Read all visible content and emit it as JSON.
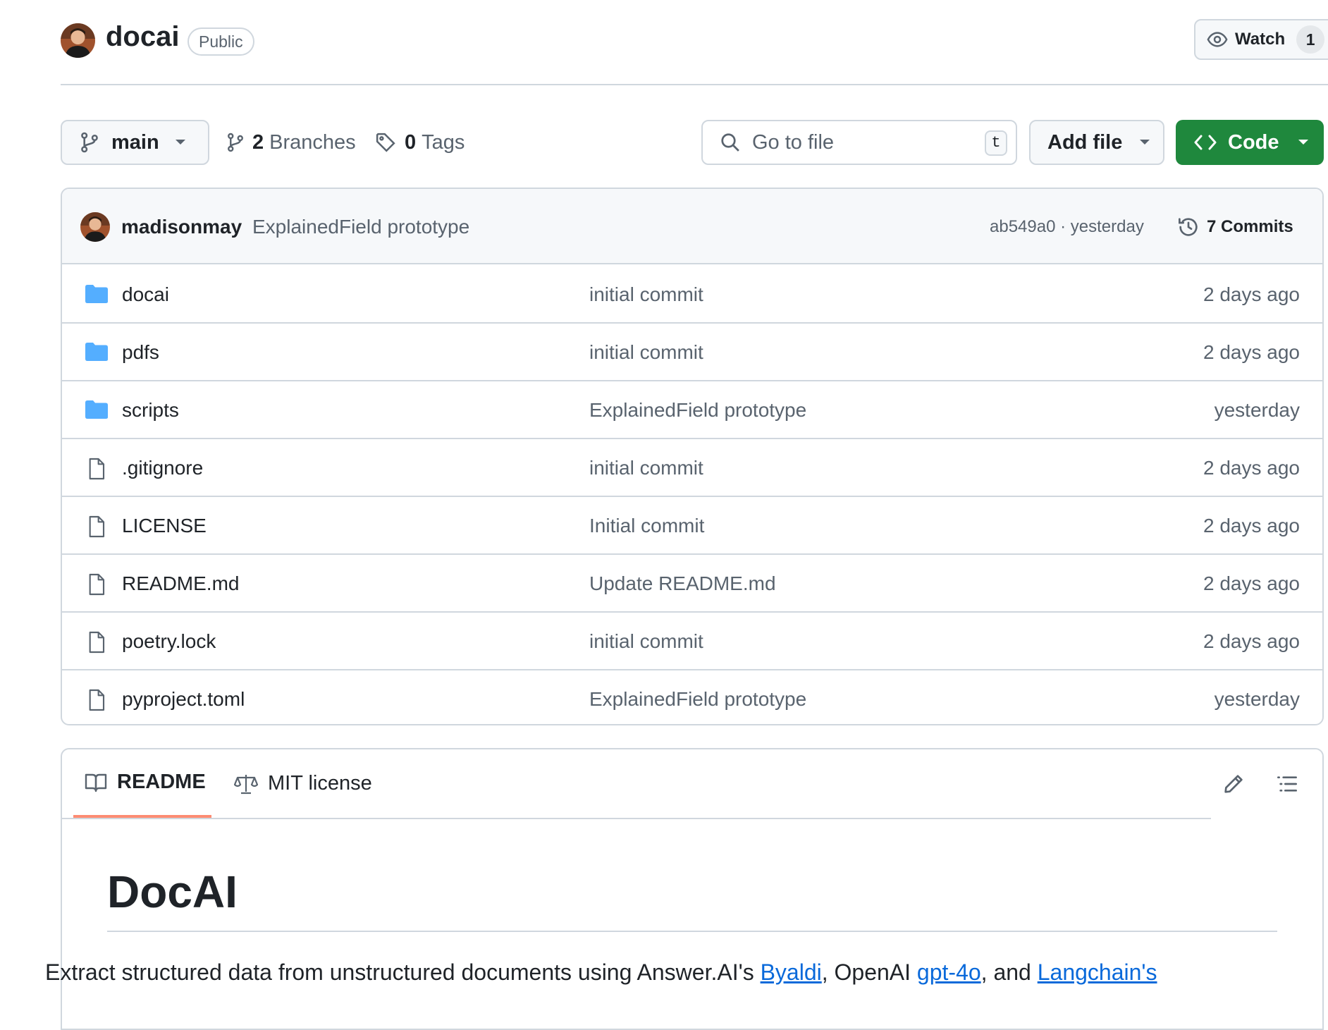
{
  "repo": {
    "name": "docai",
    "visibility": "Public",
    "watch_label": "Watch",
    "watch_count": "1"
  },
  "toolbar": {
    "branch": "main",
    "branches_count": "2",
    "branches_label": "Branches",
    "tags_count": "0",
    "tags_label": "Tags",
    "goto_placeholder": "Go to file",
    "goto_shortcut": "t",
    "add_file_label": "Add file",
    "code_label": "Code"
  },
  "latest_commit": {
    "author": "madisonmay",
    "message": "ExplainedField prototype",
    "meta": "ab549a0 · yesterday",
    "commits_label": "7 Commits"
  },
  "files": [
    {
      "name": "docai",
      "type": "folder",
      "message": "initial commit",
      "date": "2 days ago"
    },
    {
      "name": "pdfs",
      "type": "folder",
      "message": "initial commit",
      "date": "2 days ago"
    },
    {
      "name": "scripts",
      "type": "folder",
      "message": "ExplainedField prototype",
      "date": "yesterday"
    },
    {
      "name": ".gitignore",
      "type": "file",
      "message": "initial commit",
      "date": "2 days ago"
    },
    {
      "name": "LICENSE",
      "type": "file",
      "message": "Initial commit",
      "date": "2 days ago"
    },
    {
      "name": "README.md",
      "type": "file",
      "message": "Update README.md",
      "date": "2 days ago"
    },
    {
      "name": "poetry.lock",
      "type": "file",
      "message": "initial commit",
      "date": "2 days ago"
    },
    {
      "name": "pyproject.toml",
      "type": "file",
      "message": "ExplainedField prototype",
      "date": "yesterday"
    }
  ],
  "readme": {
    "tab_readme": "README",
    "tab_license": "MIT license",
    "title": "DocAI",
    "desc_prefix": "Extract structured data from unstructured documents using Answer.AI's ",
    "link_byaldi": "Byaldi",
    "desc_mid1": ", OpenAI ",
    "link_gpt": "gpt-4o",
    "desc_mid2": ", and ",
    "link_langchain": "Langchain's"
  },
  "colors": {
    "accent_green": "#1f883d",
    "folder_blue": "#54aeff",
    "link_blue": "#0969da",
    "tab_underline": "#fd8c73"
  }
}
